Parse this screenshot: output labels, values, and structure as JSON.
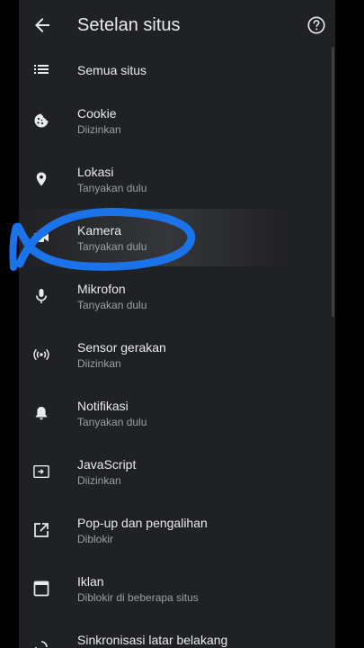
{
  "header": {
    "title": "Setelan situs"
  },
  "items": [
    {
      "icon": "list-icon",
      "label": "Semua situs",
      "sub": ""
    },
    {
      "icon": "cookie-icon",
      "label": "Cookie",
      "sub": "Diizinkan"
    },
    {
      "icon": "location-pin-icon",
      "label": "Lokasi",
      "sub": "Tanyakan dulu"
    },
    {
      "icon": "videocam-icon",
      "label": "Kamera",
      "sub": "Tanyakan dulu"
    },
    {
      "icon": "mic-icon",
      "label": "Mikrofon",
      "sub": "Tanyakan dulu"
    },
    {
      "icon": "sensors-icon",
      "label": "Sensor gerakan",
      "sub": "Diizinkan"
    },
    {
      "icon": "bell-icon",
      "label": "Notifikasi",
      "sub": "Tanyakan dulu"
    },
    {
      "icon": "code-icon",
      "label": "JavaScript",
      "sub": "Diizinkan"
    },
    {
      "icon": "open-in-new-icon",
      "label": "Pop-up dan pengalihan",
      "sub": "Diblokir"
    },
    {
      "icon": "ads-icon",
      "label": "Iklan",
      "sub": "Diblokir di beberapa situs"
    },
    {
      "icon": "sync-icon",
      "label": "Sinkronisasi latar belakang",
      "sub": ""
    }
  ],
  "colors": {
    "background": "#202124",
    "text_primary": "#e8eaed",
    "text_secondary": "#9aa0a6",
    "annotation": "#1a73e8"
  }
}
